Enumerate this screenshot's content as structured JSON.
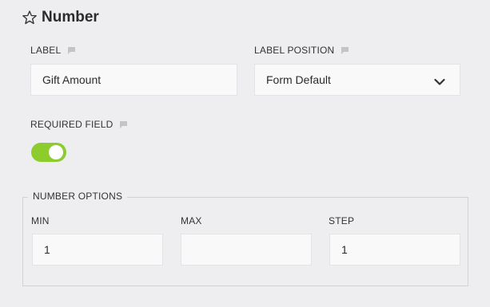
{
  "header": {
    "title": "Number",
    "icon": "star-outline-icon"
  },
  "label_field": {
    "label": "LABEL",
    "value": "Gift Amount"
  },
  "label_position": {
    "label": "LABEL POSITION",
    "selected": "Form Default"
  },
  "required_field": {
    "label": "REQUIRED FIELD",
    "enabled": true
  },
  "number_options": {
    "legend": "NUMBER OPTIONS",
    "min": {
      "label": "MIN",
      "value": "1"
    },
    "max": {
      "label": "MAX",
      "value": ""
    },
    "step": {
      "label": "STEP",
      "value": "1"
    }
  },
  "colors": {
    "background": "#eeeef0",
    "toggle_on": "#8ccc2c",
    "input_bg": "#f9f9f9",
    "help_icon": "#c4c4c8"
  }
}
